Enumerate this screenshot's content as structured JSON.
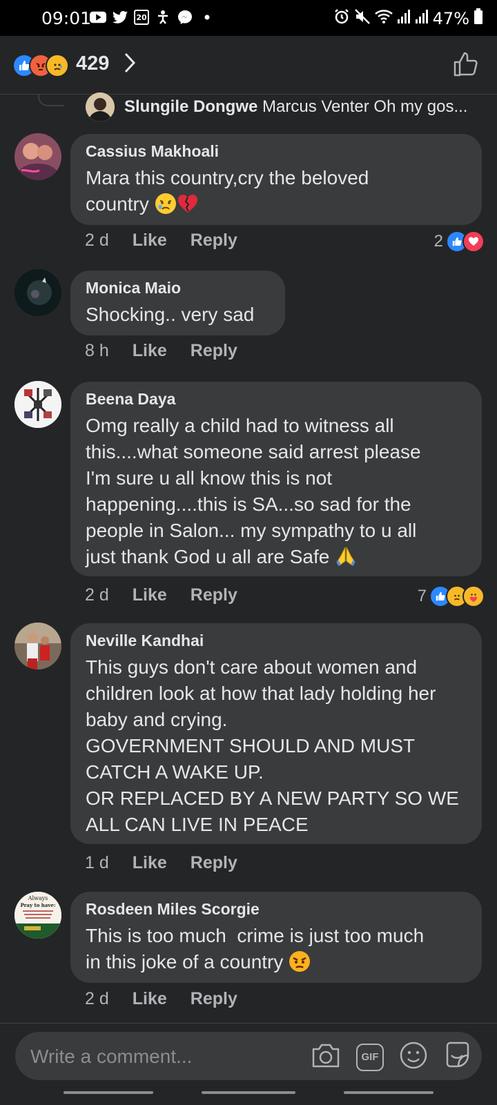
{
  "status_bar": {
    "time": "09:01",
    "notification_badge": "20",
    "battery": "47%",
    "icons_left": [
      "youtube-icon",
      "twitter-icon",
      "calendar-icon",
      "accessibility-icon",
      "messenger-icon",
      "dot-icon"
    ],
    "icons_right": [
      "alarm-icon",
      "mute-icon",
      "wifi-icon",
      "signal-icon",
      "signal-icon",
      "battery-icon"
    ]
  },
  "header": {
    "reaction_count": "429",
    "reactions": [
      "like",
      "angry",
      "sad"
    ]
  },
  "reply_preview": {
    "author": "Slungile Dongwe",
    "text": "Marcus Venter Oh my gos..."
  },
  "comments": [
    {
      "author": "Cassius Makhoali",
      "text": "Mara this country,cry the beloved\ncountry",
      "emojis": [
        "crying-face",
        "broken-heart"
      ],
      "time": "2 d",
      "like": "Like",
      "reply": "Reply",
      "reaction_count": "2",
      "reactions": [
        "like",
        "love"
      ]
    },
    {
      "author": "Monica Maio",
      "text": "Shocking.. very sad",
      "emojis": [],
      "time": "8 h",
      "like": "Like",
      "reply": "Reply",
      "reaction_count": "",
      "reactions": []
    },
    {
      "author": "Beena Daya",
      "text": "Omg really a child had to witness all\nthis....what someone said arrest please\nI'm sure u all know this is not\nhappening....this is SA...so sad for the\npeople in Salon... my sympathy to u all\njust thank God u all are Safe",
      "emojis": [
        "folded-hands"
      ],
      "time": "2 d",
      "like": "Like",
      "reply": "Reply",
      "reaction_count": "7",
      "reactions": [
        "like",
        "sad",
        "care"
      ]
    },
    {
      "author": "Neville Kandhai",
      "text": "This guys don't care about women and\nchildren look at how that lady holding her\nbaby and crying.\nGOVERNMENT SHOULD AND MUST\nCATCH A WAKE UP.\nOR REPLACED BY A NEW PARTY SO WE\nALL CAN LIVE IN PEACE",
      "emojis": [],
      "time": "1 d",
      "like": "Like",
      "reply": "Reply",
      "reaction_count": "",
      "reactions": []
    },
    {
      "author": "Rosdeen Miles Scorgie",
      "text": "This is too much  crime is just too much\nin this joke of a country",
      "emojis": [
        "angry-face"
      ],
      "time": "2 d",
      "like": "Like",
      "reply": "Reply",
      "reaction_count": "",
      "reactions": []
    }
  ],
  "avatar_texts": {
    "rosdeen_line1": "Always",
    "rosdeen_line2": "Pray to have:"
  },
  "composer": {
    "placeholder": "Write a comment...",
    "gif_label": "GIF"
  },
  "colors": {
    "background": "#242526",
    "bubble": "#3a3b3c",
    "like_blue": "#2d88ff",
    "love_red": "#f33e58",
    "meta_gray": "#b0b3b8"
  }
}
